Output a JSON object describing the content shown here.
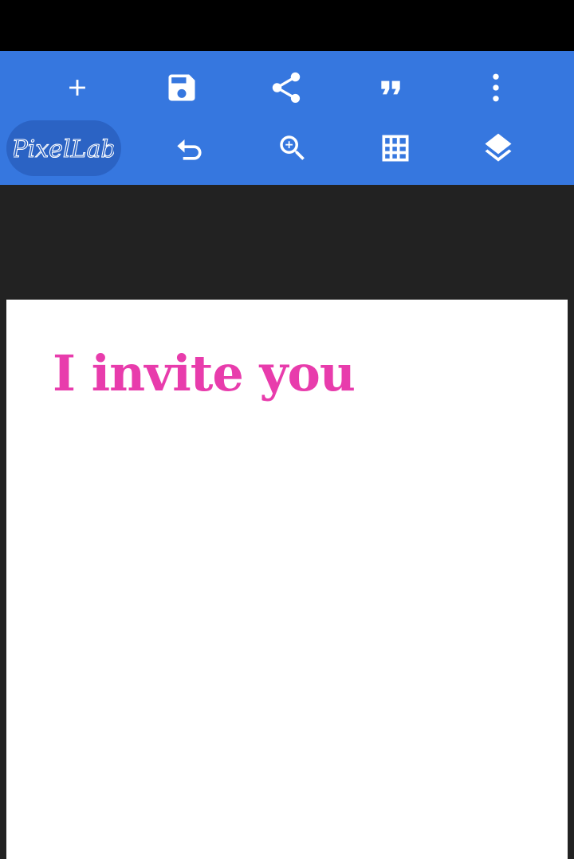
{
  "app": {
    "logo_text": "PixelLab"
  },
  "toolbar": {
    "row1": [
      {
        "icon": "plus-icon"
      },
      {
        "icon": "save-icon"
      },
      {
        "icon": "share-icon"
      },
      {
        "icon": "quote-icon"
      },
      {
        "icon": "more-vertical-icon"
      }
    ],
    "row2": [
      {
        "icon": "undo-icon"
      },
      {
        "icon": "zoom-in-icon"
      },
      {
        "icon": "grid-icon"
      },
      {
        "icon": "layers-icon"
      }
    ]
  },
  "canvas": {
    "text": "I invite you",
    "text_color": "#e83cac"
  },
  "colors": {
    "toolbar": "#3677df",
    "logo_pill": "#2b63c4",
    "workspace": "#222222",
    "status_bar": "#000000",
    "canvas": "#ffffff"
  }
}
